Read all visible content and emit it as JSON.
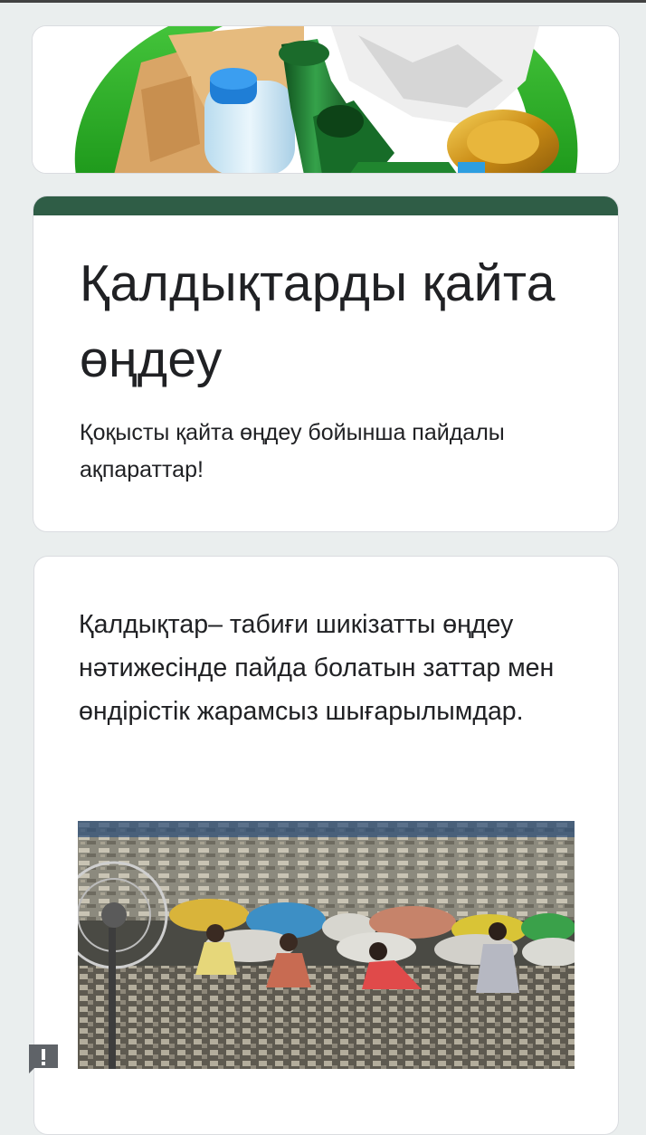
{
  "form": {
    "title": "Қалдықтарды қайта өңдеу",
    "description": "Қоқысты қайта өңдеу бойынша пайдалы ақпараттар!",
    "accent_color": "#2f5d46"
  },
  "banner": {
    "image_icon": "recycling-materials-banner"
  },
  "item": {
    "text": "Қалдықтар– табиғи шикізатты өңдеу нәтижесінде пайда болатын заттар мен өндірістік жарамсыз шығарылымдар.",
    "image_icon": "waste-sorting-photo"
  },
  "feedback": {
    "icon": "report-feedback-icon"
  }
}
